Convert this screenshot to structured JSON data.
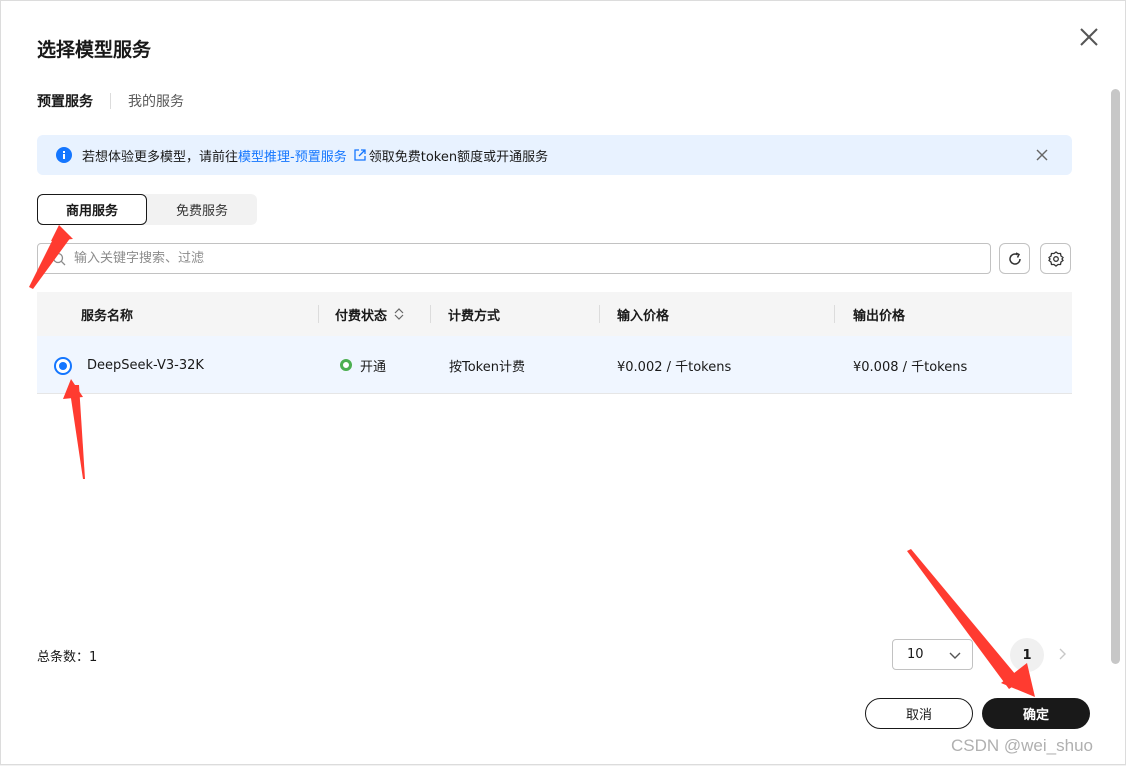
{
  "dialog": {
    "title": "选择模型服务"
  },
  "tabs": [
    {
      "label": "预置服务",
      "active": true
    },
    {
      "label": "我的服务",
      "active": false
    }
  ],
  "alert": {
    "text_before": "若想体验更多模型，请前往",
    "link_text": "模型推理-预置服务",
    "text_after": "领取免费token额度或开通服务",
    "icon": "info-icon"
  },
  "segment": {
    "options": [
      {
        "label": "商用服务",
        "active": true
      },
      {
        "label": "免费服务",
        "active": false
      }
    ]
  },
  "search": {
    "placeholder": "输入关键字搜索、过滤",
    "value": ""
  },
  "table": {
    "columns": [
      "服务名称",
      "付费状态",
      "计费方式",
      "输入价格",
      "输出价格"
    ],
    "rows": [
      {
        "selected": true,
        "name": "DeepSeek-V3-32K",
        "status": "开通",
        "billing": "按Token计费",
        "input_price": "¥0.002 / 千tokens",
        "output_price": "¥0.008 / 千tokens"
      }
    ]
  },
  "pagination": {
    "total_label": "总条数：1",
    "page_size": "10",
    "current_page": "1"
  },
  "footer": {
    "cancel_label": "取消",
    "confirm_label": "确定"
  },
  "watermark": "CSDN @wei_shuo",
  "colors": {
    "accent": "#1476ff",
    "status_ok": "#4caf50",
    "primary_button": "#191919",
    "annotation_arrow": "#ff3b30"
  }
}
